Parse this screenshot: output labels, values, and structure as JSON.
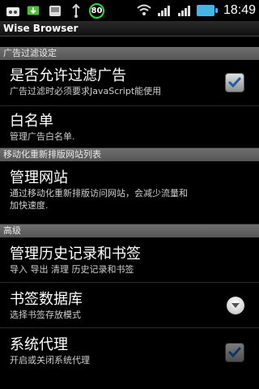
{
  "status_bar": {
    "badge_value": "80",
    "time": "18:49"
  },
  "app": {
    "title": "Wise Browser"
  },
  "sections": {
    "ad_filter": {
      "header": "广告过滤设定",
      "allow_filter": {
        "title": "是否允许过滤广告",
        "summary": "广告过滤时必须要求JavaScript能使用",
        "checked": true
      },
      "whitelist": {
        "title": "白名单",
        "summary": "管理广告白名单."
      }
    },
    "mobile_rearrange": {
      "header": "移动化重新排版网站列表",
      "manage_sites": {
        "title": "管理网站",
        "summary_line1": "通过移动化重新排版访问网站，会减少流量和",
        "summary_line2": "加快速度."
      }
    },
    "advanced": {
      "header": "高级",
      "history_bookmarks": {
        "title": "管理历史记录和书签",
        "summary": "导入 导出 清理 历史记录和书签"
      },
      "bookmark_db": {
        "title": "书签数据库",
        "summary": "选择书签存放模式"
      },
      "system_proxy": {
        "title": "系统代理",
        "summary": "开启或关闭系统代理",
        "checked": true
      }
    }
  },
  "colors": {
    "accent_blue": "#45b4e6",
    "badge_green": "#36d84a",
    "section_header": "#5f5f5f"
  }
}
